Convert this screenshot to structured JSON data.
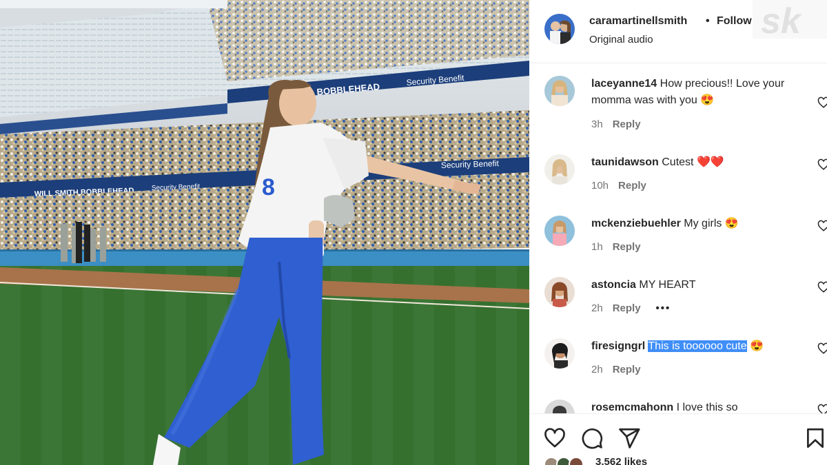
{
  "post": {
    "username": "caramartinellsmith",
    "separator": "•",
    "follow_label": "Follow",
    "audio_label": "Original audio",
    "watermark": "sk",
    "likes_text": "3,562 likes"
  },
  "media": {
    "banners": [
      "BOBBLEHEAD",
      "Security Benefit",
      "WILL SMITH BOBBLEHEAD",
      "Security Benefit",
      "Security Benefit"
    ],
    "jersey_number": "8"
  },
  "comments": [
    {
      "username": "laceyanne14",
      "text": "How precious!! Love your momma was with you",
      "emoji": "😍",
      "time": "3h",
      "reply": "Reply"
    },
    {
      "username": "taunidawson",
      "text": "Cutest",
      "emoji": "❤️❤️",
      "time": "10h",
      "reply": "Reply"
    },
    {
      "username": "mckenziebuehler",
      "text": "My girls",
      "emoji": "😍",
      "time": "1h",
      "reply": "Reply"
    },
    {
      "username": "astoncia",
      "text": "MY HEART",
      "emoji": "",
      "time": "2h",
      "reply": "Reply",
      "more": "•••"
    },
    {
      "username": "firesigngrl",
      "text": "This is toooooo cute",
      "emoji": "😍",
      "time": "2h",
      "reply": "Reply",
      "highlighted": true
    },
    {
      "username": "rosemcmahonn",
      "text": "I love this so",
      "emoji": "",
      "time": "",
      "reply": ""
    }
  ],
  "icons": [
    "heart-icon",
    "comment-icon",
    "share-icon",
    "bookmark-icon"
  ],
  "colors": {
    "highlight": "#3f8ef8",
    "meta": "#737373",
    "text": "#262626",
    "heart_red": "#e0245e",
    "jersey_blue": "#2c5bcf"
  }
}
